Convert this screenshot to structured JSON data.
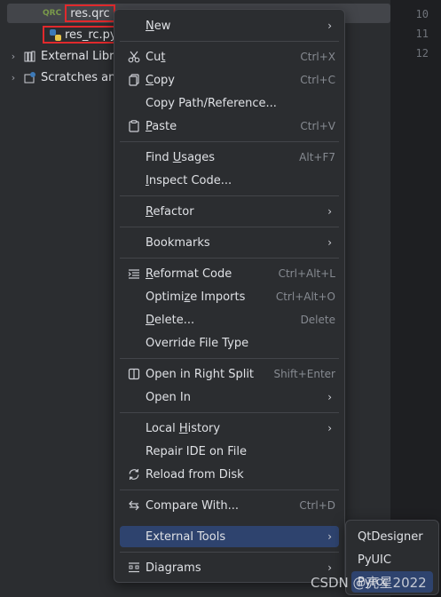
{
  "tree": {
    "items": [
      {
        "label": "res.qrc",
        "icon": "qrc-file-icon",
        "icon_text": "QRC"
      },
      {
        "label": "res_rc.py",
        "icon": "python-file-icon"
      },
      {
        "label": "External Libra",
        "icon": "library-icon"
      },
      {
        "label": "Scratches and",
        "icon": "scratches-icon"
      }
    ]
  },
  "editor": {
    "line_numbers": [
      "10",
      "11",
      "12"
    ]
  },
  "menu": {
    "items": [
      {
        "label": "New",
        "mnemonic_pre": "",
        "mnemonic": "N",
        "mnemonic_post": "ew",
        "shortcut": "",
        "submenu": true,
        "icon": ""
      },
      {
        "label": "Cut",
        "mnemonic_pre": "Cu",
        "mnemonic": "t",
        "mnemonic_post": "",
        "shortcut": "Ctrl+X",
        "icon": "scissors-icon"
      },
      {
        "label": "Copy",
        "mnemonic_pre": "",
        "mnemonic": "C",
        "mnemonic_post": "opy",
        "shortcut": "Ctrl+C",
        "icon": "copy-icon"
      },
      {
        "label": "Copy Path/Reference...",
        "shortcut": "",
        "icon": ""
      },
      {
        "label": "Paste",
        "mnemonic_pre": "",
        "mnemonic": "P",
        "mnemonic_post": "aste",
        "shortcut": "Ctrl+V",
        "icon": "paste-icon"
      },
      {
        "label": "Find Usages",
        "mnemonic_pre": "Find ",
        "mnemonic": "U",
        "mnemonic_post": "sages",
        "shortcut": "Alt+F7",
        "icon": ""
      },
      {
        "label": "Inspect Code...",
        "mnemonic_pre": "",
        "mnemonic": "I",
        "mnemonic_post": "nspect Code...",
        "shortcut": "",
        "icon": ""
      },
      {
        "label": "Refactor",
        "mnemonic_pre": "",
        "mnemonic": "R",
        "mnemonic_post": "efactor",
        "submenu": true,
        "icon": ""
      },
      {
        "label": "Bookmarks",
        "submenu": true,
        "icon": ""
      },
      {
        "label": "Reformat Code",
        "mnemonic_pre": "",
        "mnemonic": "R",
        "mnemonic_post": "eformat Code",
        "shortcut": "Ctrl+Alt+L",
        "icon": "reformat-icon"
      },
      {
        "label": "Optimize Imports",
        "mnemonic_pre": "Optimi",
        "mnemonic": "z",
        "mnemonic_post": "e Imports",
        "shortcut": "Ctrl+Alt+O",
        "icon": ""
      },
      {
        "label": "Delete...",
        "mnemonic_pre": "",
        "mnemonic": "D",
        "mnemonic_post": "elete...",
        "shortcut": "Delete",
        "icon": ""
      },
      {
        "label": "Override File Type",
        "shortcut": "",
        "icon": ""
      },
      {
        "label": "Open in Right Split",
        "shortcut": "Shift+Enter",
        "icon": "split-icon"
      },
      {
        "label": "Open In",
        "submenu": true,
        "icon": ""
      },
      {
        "label": "Local History",
        "mnemonic_pre": "Local ",
        "mnemonic": "H",
        "mnemonic_post": "istory",
        "submenu": true,
        "icon": ""
      },
      {
        "label": "Repair IDE on File",
        "icon": ""
      },
      {
        "label": "Reload from Disk",
        "icon": "reload-icon"
      },
      {
        "label": "Compare With...",
        "shortcut": "Ctrl+D",
        "icon": "compare-icon"
      },
      {
        "label": "External Tools",
        "submenu": true,
        "icon": ""
      },
      {
        "label": "Diagrams",
        "submenu": true,
        "icon": "diagram-icon"
      }
    ]
  },
  "submenu": {
    "items": [
      "QtDesigner",
      "PyUIC",
      "Pyrcc"
    ]
  },
  "watermark": "CSDN @亮星2022"
}
